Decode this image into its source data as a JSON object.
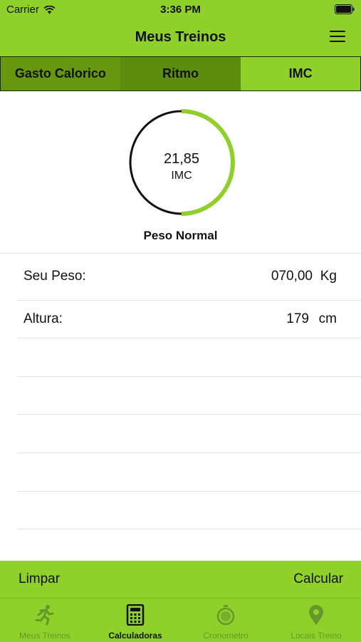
{
  "status_bar": {
    "carrier": "Carrier",
    "time": "3:36 PM"
  },
  "nav": {
    "title": "Meus Treinos"
  },
  "tabs_segment": [
    {
      "label": "Gasto Calorico"
    },
    {
      "label": "Ritmo"
    },
    {
      "label": "IMC"
    }
  ],
  "gauge": {
    "value": "21,85",
    "unit": "IMC",
    "category": "Peso Normal",
    "fill_fraction": 0.5
  },
  "form": {
    "weight_label": "Seu Peso:",
    "weight_value": "070,00",
    "weight_unit": "Kg",
    "height_label": "Altura:",
    "height_value": "179",
    "height_unit": "cm"
  },
  "actions": {
    "clear": "Limpar",
    "calculate": "Calcular"
  },
  "tabbar": [
    {
      "label": "Meus Treinos",
      "icon": "runner-icon"
    },
    {
      "label": "Calculadoras",
      "icon": "calculator-icon"
    },
    {
      "label": "Cronometro",
      "icon": "stopwatch-icon"
    },
    {
      "label": "Locais Treino",
      "icon": "location-pin-icon"
    }
  ],
  "colors": {
    "brand_green": "#8fd12a",
    "segment_dark": "#67970f",
    "tab_inactive": "#67962b"
  }
}
